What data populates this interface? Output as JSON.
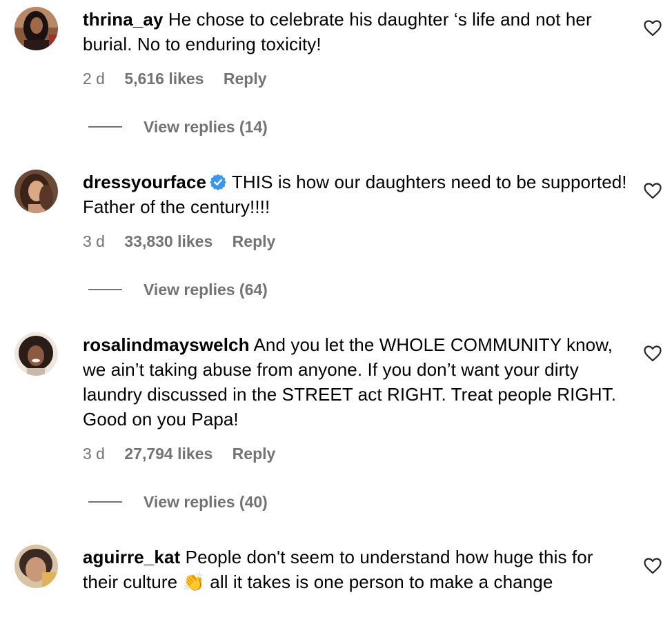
{
  "comments": [
    {
      "username": "thrina_ay",
      "verified": false,
      "text": "He chose to celebrate his daughter ‘s life and not her burial. No to enduring toxicity!",
      "age": "2 d",
      "likes": "5,616 likes",
      "reply_label": "Reply",
      "view_replies": "View replies (14)",
      "avatar_icon": "avatar-photo-icon"
    },
    {
      "username": "dressyourface",
      "verified": true,
      "text": "THIS is how our daughters need to be supported! Father of the century!!!!",
      "age": "3 d",
      "likes": "33,830 likes",
      "reply_label": "Reply",
      "view_replies": "View replies (64)",
      "avatar_icon": "avatar-photo-icon"
    },
    {
      "username": "rosalindmayswelch",
      "verified": false,
      "text": "And you let the WHOLE COMMUNITY know, we ain’t taking abuse from anyone. If you don’t want your dirty laundry discussed in the STREET act RIGHT. Treat people RIGHT. Good on you Papa!",
      "age": "3 d",
      "likes": "27,794 likes",
      "reply_label": "Reply",
      "view_replies": "View replies (40)",
      "avatar_icon": "avatar-photo-icon"
    },
    {
      "username": "aguirre_kat",
      "verified": false,
      "text_before_emoji": "People don't seem to understand how huge this for their culture",
      "emoji": "👏",
      "text_after_emoji": "all it takes is one person to make a change",
      "avatar_icon": "avatar-photo-icon"
    }
  ],
  "colors": {
    "text": "#000000",
    "meta": "#737373",
    "verified_badge": "#3897f0"
  },
  "icons": {
    "like": "heart-outline-icon",
    "verified": "verified-badge-icon"
  }
}
